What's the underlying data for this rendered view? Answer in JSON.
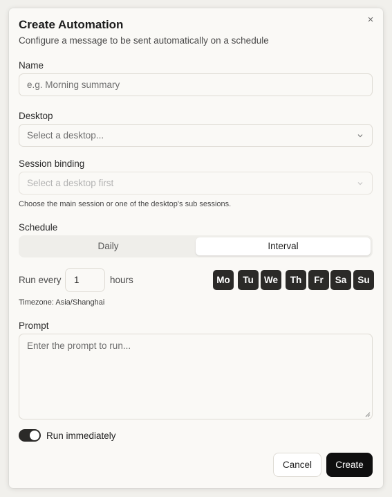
{
  "dialog": {
    "title": "Create Automation",
    "subtitle": "Configure a message to be sent automatically on a schedule",
    "close_icon": "×"
  },
  "name": {
    "label": "Name",
    "placeholder": "e.g. Morning summary"
  },
  "desktop": {
    "label": "Desktop",
    "selected": "Select a desktop..."
  },
  "session": {
    "label": "Session binding",
    "selected": "Select a desktop first",
    "hint": "Choose the main session or one of the desktop's sub sessions."
  },
  "schedule": {
    "label": "Schedule",
    "options": [
      "Daily",
      "Interval"
    ],
    "active": "Interval",
    "run_every_label": "Run every",
    "interval_value": "1",
    "unit_label": "hours",
    "days": [
      "Mo",
      "Tu",
      "We",
      "Th",
      "Fr",
      "Sa",
      "Su"
    ],
    "timezone": "Timezone: Asia/Shanghai"
  },
  "prompt": {
    "label": "Prompt",
    "placeholder": "Enter the prompt to run..."
  },
  "run_immediately": {
    "label": "Run immediately",
    "enabled": true
  },
  "actions": {
    "cancel": "Cancel",
    "create": "Create"
  },
  "colors": {
    "primary": "#0f0f0f",
    "day_chip": "#2b2a28",
    "background": "#faf9f6"
  }
}
